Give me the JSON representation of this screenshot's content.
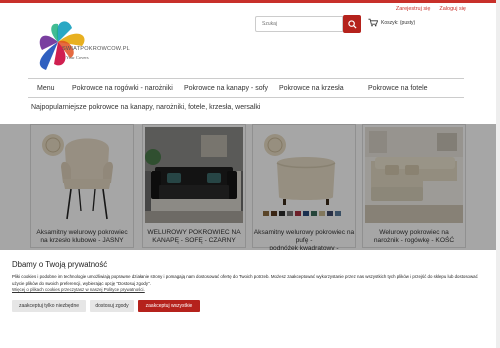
{
  "header": {
    "links": [
      "Zarejestruj się",
      "Zaloguj się"
    ],
    "logo_text": "SWIATPOKROWCOW.PL",
    "logo_subtext": "Your Covers",
    "search_placeholder": "Szukaj",
    "cart_label": "Koszyk: (pusty)"
  },
  "nav": {
    "items": [
      "Menu",
      "Pokrowce na rogówki - narożniki",
      "Pokrowce na kanapy - sofy",
      "Pokrowce na krzesła",
      "Pokrowce na fotele"
    ]
  },
  "main": {
    "heading": "Najpopularniejsze pokrowce na kanapy, narożniki, fotele, krzesła, wersalki",
    "products": [
      {
        "title_line1": "Aksamitny welurowy pokrowiec",
        "title_line2": "na krzesło klubowe - JASNY"
      },
      {
        "title_line1": "WELUROWY POKROWIEC NA",
        "title_line2": "KANAPĘ - SOFĘ - CZARNY"
      },
      {
        "title_line1": "Aksamitny welurowy pokrowiec na pufę -",
        "title_line2": "podnóżek kwadratowy -"
      },
      {
        "title_line1": "Welurowy pokrowiec na",
        "title_line2": "narożnik - rogówkę - KOŚĆ"
      }
    ]
  },
  "cookie": {
    "title": "Dbamy o Twoją prywatność",
    "description": "Pliki cookies i podobne im technologie umożliwiają poprawne działanie strony i pomagają nam dostosować ofertę do Twoich potrzeb. Możesz zaakceptować wykorzystanie przez nas wszystkich tych plików i przejść do sklepu lub dostosować użycie plików do swoich preferencji, wybierając opcję \"Dostosuj zgody\".",
    "link": "Więcej o plikach cookies przeczytasz w naszej Polityce prywatności.",
    "buttons": {
      "necessary": "zaakceptuj tylko niezbędne",
      "customize": "dostosuj zgody",
      "accept_all": "zaakceptuj wszystkie"
    }
  },
  "colors": {
    "accent": "#b5221c"
  }
}
